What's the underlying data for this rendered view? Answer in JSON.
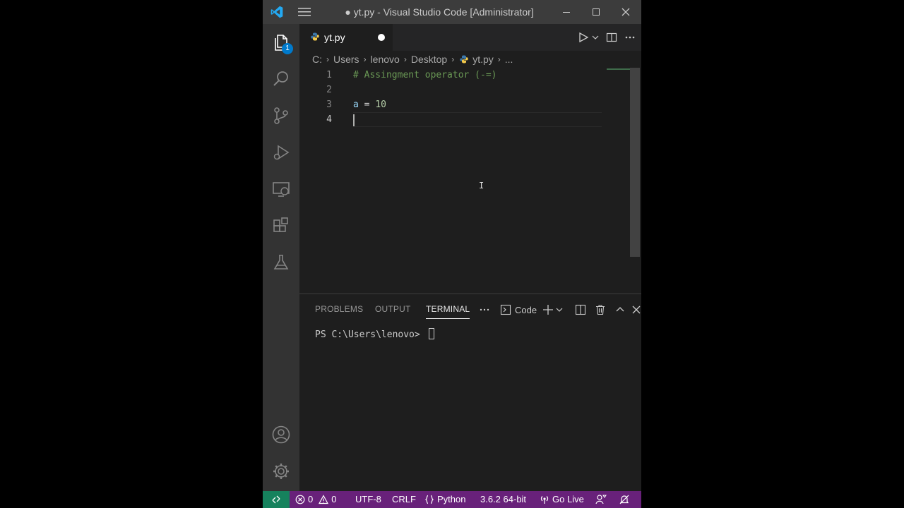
{
  "window": {
    "title": "● yt.py - Visual Studio Code [Administrator]"
  },
  "activity_bar": {
    "explorer_badge": "1",
    "items": [
      "files-icon",
      "search-icon",
      "source-control-icon",
      "run-debug-icon",
      "remote-explorer-icon",
      "extensions-icon",
      "testing-icon"
    ],
    "bottom": [
      "account-icon",
      "settings-gear-icon"
    ]
  },
  "tab": {
    "label": "yt.py"
  },
  "breadcrumb": [
    "C:",
    "Users",
    "lenovo",
    "Desktop",
    "yt.py",
    "..."
  ],
  "editor": {
    "lines": [
      {
        "number": "1",
        "comment": "# Assingment operator (-=)"
      },
      {
        "number": "2"
      },
      {
        "number": "3",
        "var": "a",
        "op": " = ",
        "num": "10"
      },
      {
        "number": "4"
      }
    ],
    "active_line": 4
  },
  "panel": {
    "tabs": [
      "PROBLEMS",
      "OUTPUT",
      "TERMINAL"
    ],
    "active_tab": "TERMINAL",
    "terminal_name": "Code",
    "prompt": "PS C:\\Users\\lenovo> "
  },
  "status_bar": {
    "errors": "0",
    "warnings": "0",
    "encoding": "UTF-8",
    "line_ending": "CRLF",
    "language": "Python",
    "interpreter": "3.6.2 64-bit",
    "go_live": "Go Live"
  },
  "colors": {
    "status_bar": "#68217a",
    "remote": "#16825d",
    "accent": "#007acc",
    "comment": "#6a9955",
    "number": "#b5cea8",
    "variable": "#9cdcfe"
  }
}
